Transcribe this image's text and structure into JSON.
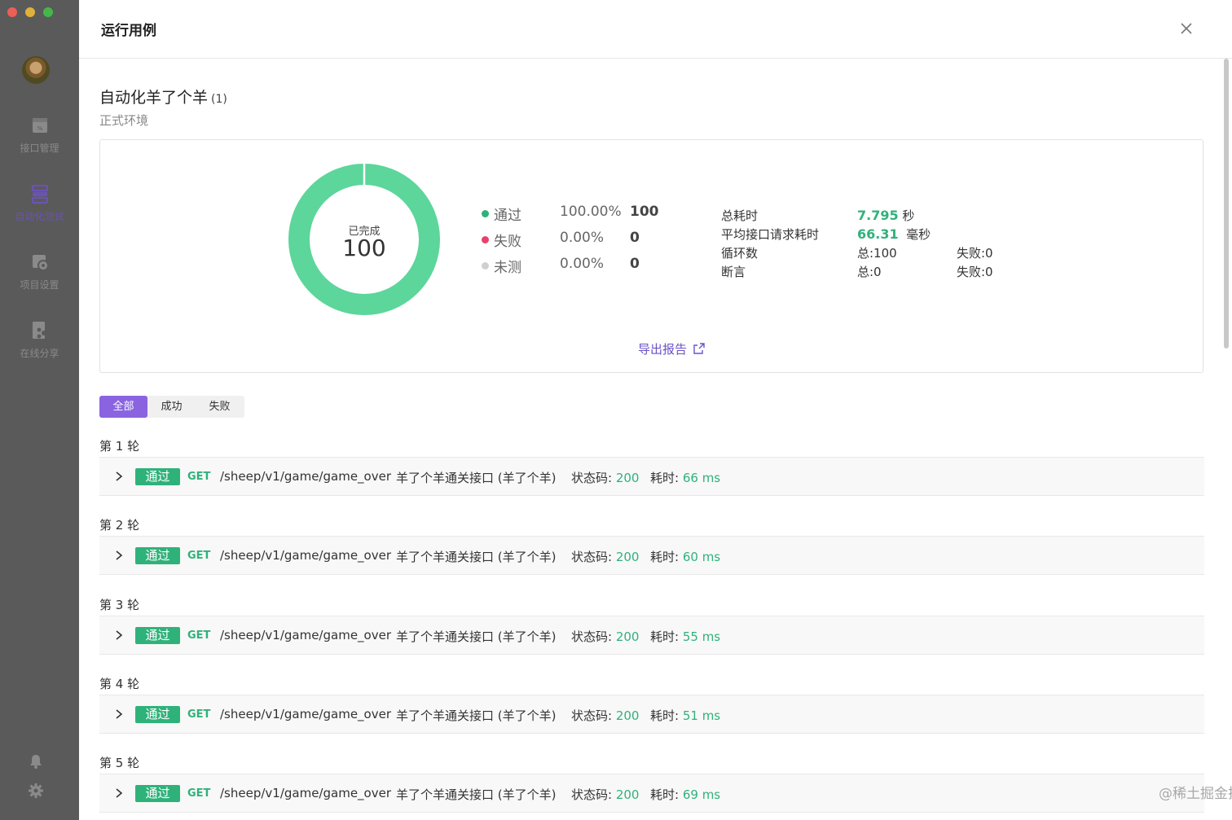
{
  "app": {
    "window_title": "运行用例",
    "sidebar_items": [
      {
        "label": "接口管理",
        "icon": "api-doc-icon",
        "active": false
      },
      {
        "label": "自动化测试",
        "icon": "automation-icon",
        "active": true
      },
      {
        "label": "项目设置",
        "icon": "project-settings-icon",
        "active": false
      },
      {
        "label": "在线分享",
        "icon": "share-icon",
        "active": false
      }
    ]
  },
  "run": {
    "title": "自动化羊了个羊",
    "count": "(1)",
    "environment": "正式环境"
  },
  "summary": {
    "donut_label": "已完成",
    "donut_value": "100",
    "pass_ratio": 1.0,
    "legend": [
      {
        "name": "通过",
        "pct": "100.00%",
        "count": "100",
        "color": "#2fb27a"
      },
      {
        "name": "失败",
        "pct": "0.00%",
        "count": "0",
        "color": "#e8416b"
      },
      {
        "name": "未测",
        "pct": "0.00%",
        "count": "0",
        "color": "#d0d0d0"
      }
    ],
    "total_time_label": "总耗时",
    "total_time_value": "7.795",
    "total_time_unit": "秒",
    "avg_time_label": "平均接口请求耗时",
    "avg_time_value": "66.31",
    "avg_time_unit": "毫秒",
    "loops_label": "循环数",
    "loops_total": "总:100",
    "loops_failed": "失败:0",
    "assert_label": "断言",
    "assert_total": "总:0",
    "assert_failed": "失败:0",
    "export_label": "导出报告"
  },
  "filters": [
    "全部",
    "成功",
    "失败"
  ],
  "rounds": [
    {
      "label": "第 1 轮",
      "status": "通过",
      "method": "GET",
      "path": "/sheep/v1/game/game_over",
      "name": "羊了个羊通关接口 (羊了个羊)",
      "code_label": "状态码:",
      "code": "200",
      "time_label": "耗时:",
      "time": "66 ms"
    },
    {
      "label": "第 2 轮",
      "status": "通过",
      "method": "GET",
      "path": "/sheep/v1/game/game_over",
      "name": "羊了个羊通关接口 (羊了个羊)",
      "code_label": "状态码:",
      "code": "200",
      "time_label": "耗时:",
      "time": "60 ms"
    },
    {
      "label": "第 3 轮",
      "status": "通过",
      "method": "GET",
      "path": "/sheep/v1/game/game_over",
      "name": "羊了个羊通关接口 (羊了个羊)",
      "code_label": "状态码:",
      "code": "200",
      "time_label": "耗时:",
      "time": "55 ms"
    },
    {
      "label": "第 4 轮",
      "status": "通过",
      "method": "GET",
      "path": "/sheep/v1/game/game_over",
      "name": "羊了个羊通关接口 (羊了个羊)",
      "code_label": "状态码:",
      "code": "200",
      "time_label": "耗时:",
      "time": "51 ms"
    },
    {
      "label": "第 5 轮",
      "status": "通过",
      "method": "GET",
      "path": "/sheep/v1/game/game_over",
      "name": "羊了个羊通关接口 (羊了个羊)",
      "code_label": "状态码:",
      "code": "200",
      "time_label": "耗时:",
      "time": "69 ms"
    }
  ],
  "watermark": "@稀土掘金技术社区",
  "colors": {
    "accent": "#8a64e0",
    "pass": "#2fb27a",
    "fail": "#e8416b",
    "untested": "#d0d0d0"
  }
}
